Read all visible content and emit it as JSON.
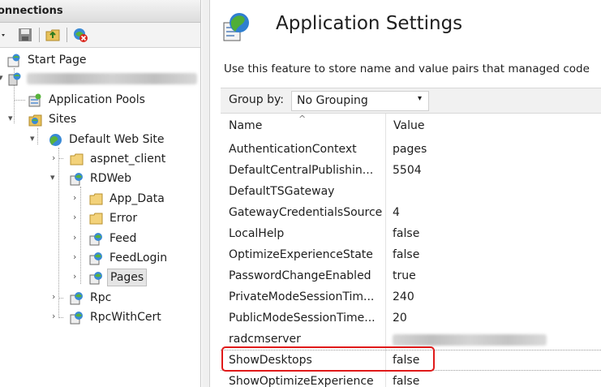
{
  "connections": {
    "header": "onnections",
    "tree": [
      {
        "label": "Start Page",
        "icon": "start-page-icon"
      },
      {
        "label": "",
        "icon": "server-icon"
      },
      {
        "label": "Application Pools",
        "icon": "app-pools-icon"
      },
      {
        "label": "Sites",
        "icon": "sites-icon"
      },
      {
        "label": "Default Web Site",
        "icon": "globe-icon"
      },
      {
        "label": "aspnet_client",
        "icon": "folder-icon"
      },
      {
        "label": "RDWeb",
        "icon": "web-app-icon"
      },
      {
        "label": "App_Data",
        "icon": "folder-icon"
      },
      {
        "label": "Error",
        "icon": "folder-icon"
      },
      {
        "label": "Feed",
        "icon": "web-app-icon"
      },
      {
        "label": "FeedLogin",
        "icon": "web-app-icon"
      },
      {
        "label": "Pages",
        "icon": "web-app-icon"
      },
      {
        "label": "Rpc",
        "icon": "web-app-icon"
      },
      {
        "label": "RpcWithCert",
        "icon": "web-app-icon"
      }
    ]
  },
  "main": {
    "title": "Application Settings",
    "description": "Use this feature to store name and value pairs that managed code",
    "group_by_label": "Group by:",
    "group_by_value": "No Grouping",
    "columns": {
      "name": "Name",
      "value": "Value"
    },
    "rows": [
      {
        "name": "AuthenticationContext",
        "value": "pages"
      },
      {
        "name": "DefaultCentralPublishin...",
        "value": "5504"
      },
      {
        "name": "DefaultTSGateway",
        "value": ""
      },
      {
        "name": "GatewayCredentialsSource",
        "value": "4"
      },
      {
        "name": "LocalHelp",
        "value": "false"
      },
      {
        "name": "OptimizeExperienceState",
        "value": "false"
      },
      {
        "name": "PasswordChangeEnabled",
        "value": "true"
      },
      {
        "name": "PrivateModeSessionTim...",
        "value": "240"
      },
      {
        "name": "PublicModeSessionTime...",
        "value": "20"
      },
      {
        "name": "radcmserver",
        "value": ""
      },
      {
        "name": "ShowDesktops",
        "value": "false"
      },
      {
        "name": "ShowOptimizeExperience",
        "value": "false"
      }
    ]
  },
  "colors": {
    "highlight": "#e01a1a",
    "selection": "#e5e5e5"
  }
}
